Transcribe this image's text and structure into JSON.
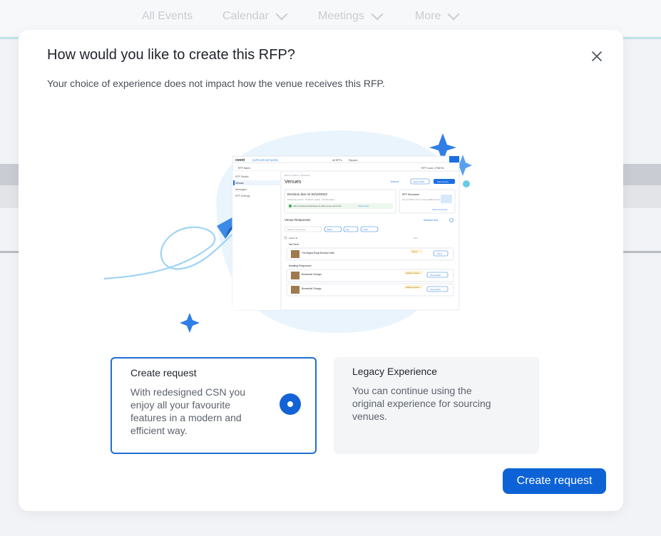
{
  "background": {
    "nav": [
      {
        "label": "All Events",
        "has_chevron": false
      },
      {
        "label": "Calendar",
        "has_chevron": true
      },
      {
        "label": "Meetings",
        "has_chevron": true
      },
      {
        "label": "More",
        "has_chevron": true
      }
    ]
  },
  "modal": {
    "title": "How would you like to create this RFP?",
    "subtitle": "Your choice of experience does not impact how the venue receives this RFP.",
    "close_icon": "close-icon",
    "illustration": {
      "brand": "cvent",
      "network_label": "SUPPLIER NETWORK",
      "top_links": [
        "All RFPs",
        "Reports"
      ],
      "rfp_name": "RFP Name",
      "rfp_code": "RFP Code: 2798761",
      "side_menu": [
        "RFP Details",
        "Venues",
        "Messages",
        "RFP Settings"
      ],
      "breadcrumb": "Event 1 Venue > Overview",
      "page_heading": "Venues",
      "actions_label": "Actions",
      "export_label": "Export RFP",
      "add_venues_label": "Add venues",
      "decision_label": "Decision due on 04/10/2022",
      "decision_meta": "3 Meeting rooms · 16 Room nights · 18 Attendees",
      "banner_text": "Add a preferred attendees to allow more event info",
      "banner_link": "Learn more",
      "showcase_title": "RFP Showcase",
      "showcase_text": "Get your RFP in front of more qualified venues",
      "showcase_link": "Add to showcase",
      "responses_heading": "Venue Responses",
      "standard_view": "Standard view",
      "filters": [
        "Search venue name",
        "Status",
        "City",
        "Chain"
      ],
      "select_all": "Select all",
      "sort_label": "Sort",
      "groups": [
        {
          "name": "Not Sent",
          "venues": [
            {
              "name": "The Magna Royal Bonavia Hotel",
              "badge": "Saved",
              "button": "Send"
            }
          ]
        },
        {
          "name": "Awaiting Responses",
          "venues": [
            {
              "name": "Bonnachel Chicago",
              "badge": "Awaiting response",
              "button": "View details"
            },
            {
              "name": "Bonnachel Chicago",
              "badge": "Awaiting response",
              "button": "View details"
            }
          ]
        }
      ]
    },
    "options": {
      "create": {
        "title": "Create request",
        "description": "With redesigned CSN you enjoy all your favourite features in a modern and efficient way.",
        "selected": true
      },
      "legacy": {
        "title": "Legacy Experience",
        "description": "You can continue using the original experience for sourcing venues.",
        "selected": false
      }
    },
    "primary_button": "Create request"
  },
  "colors": {
    "primary": "#0d63d6",
    "selected_border": "#1f6fd1",
    "illustration_blob": "#eaf4fd",
    "sparkle": "#2f7fe6"
  }
}
